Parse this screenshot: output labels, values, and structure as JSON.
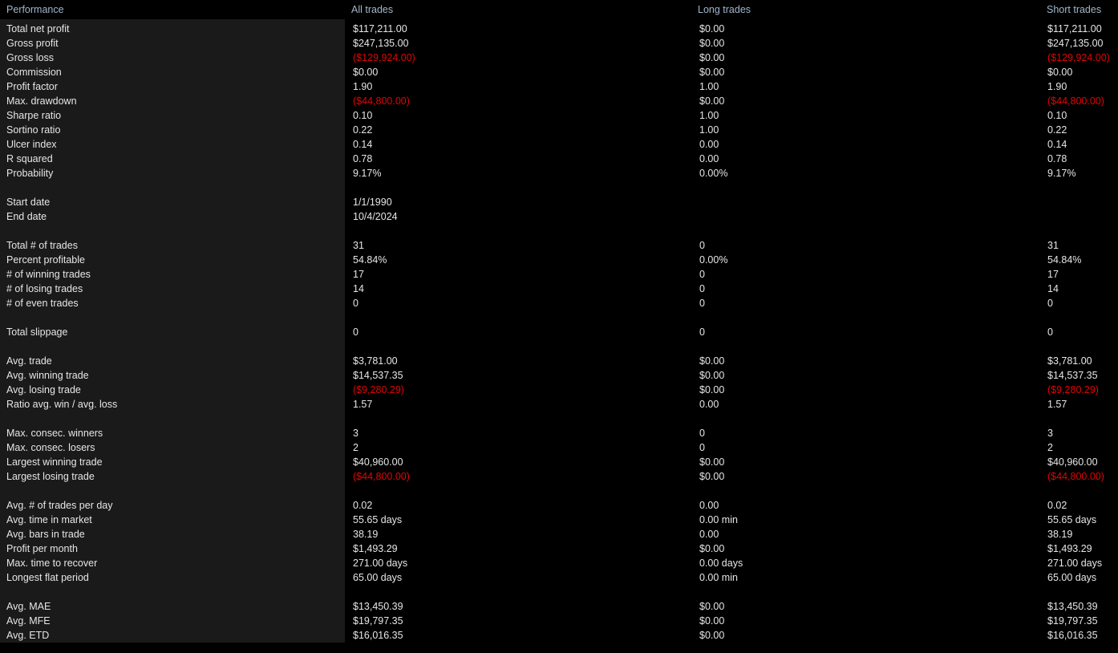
{
  "header": {
    "columns": [
      "Performance",
      "All trades",
      "Long trades",
      "Short trades"
    ]
  },
  "colors": {
    "negative": "#e00505",
    "header_text": "#a3b6ca",
    "value_text": "#e6e6e6",
    "panel_bg": "#1a1a1a",
    "page_bg": "#000000"
  },
  "rows": [
    {
      "label": "Total net profit",
      "all": "$117,211.00",
      "long": "$0.00",
      "short": "$117,211.00"
    },
    {
      "label": "Gross profit",
      "all": "$247,135.00",
      "long": "$0.00",
      "short": "$247,135.00"
    },
    {
      "label": "Gross loss",
      "all": "($129,924.00)",
      "long": "$0.00",
      "short": "($129,924.00)",
      "neg": [
        "all",
        "short"
      ]
    },
    {
      "label": "Commission",
      "all": "$0.00",
      "long": "$0.00",
      "short": "$0.00"
    },
    {
      "label": "Profit factor",
      "all": "1.90",
      "long": "1.00",
      "short": "1.90"
    },
    {
      "label": "Max. drawdown",
      "all": "($44,800.00)",
      "long": "$0.00",
      "short": "($44,800.00)",
      "neg": [
        "all",
        "short"
      ]
    },
    {
      "label": "Sharpe ratio",
      "all": "0.10",
      "long": "1.00",
      "short": "0.10"
    },
    {
      "label": "Sortino ratio",
      "all": "0.22",
      "long": "1.00",
      "short": "0.22"
    },
    {
      "label": "Ulcer index",
      "all": "0.14",
      "long": "0.00",
      "short": "0.14"
    },
    {
      "label": "R squared",
      "all": "0.78",
      "long": "0.00",
      "short": "0.78"
    },
    {
      "label": "Probability",
      "all": "9.17%",
      "long": "0.00%",
      "short": "9.17%"
    },
    {
      "spacer": true
    },
    {
      "label": "Start date",
      "all": "1/1/1990",
      "long": "",
      "short": ""
    },
    {
      "label": "End date",
      "all": "10/4/2024",
      "long": "",
      "short": ""
    },
    {
      "spacer": true
    },
    {
      "label": "Total # of trades",
      "all": "31",
      "long": "0",
      "short": "31"
    },
    {
      "label": "Percent profitable",
      "all": "54.84%",
      "long": "0.00%",
      "short": "54.84%"
    },
    {
      "label": "# of winning trades",
      "all": "17",
      "long": "0",
      "short": "17"
    },
    {
      "label": "# of losing trades",
      "all": "14",
      "long": "0",
      "short": "14"
    },
    {
      "label": "# of even trades",
      "all": "0",
      "long": "0",
      "short": "0"
    },
    {
      "spacer": true
    },
    {
      "label": "Total slippage",
      "all": "0",
      "long": "0",
      "short": "0"
    },
    {
      "spacer": true
    },
    {
      "label": "Avg. trade",
      "all": "$3,781.00",
      "long": "$0.00",
      "short": "$3,781.00"
    },
    {
      "label": "Avg. winning trade",
      "all": "$14,537.35",
      "long": "$0.00",
      "short": "$14,537.35"
    },
    {
      "label": "Avg. losing trade",
      "all": "($9,280.29)",
      "long": "$0.00",
      "short": "($9,280.29)",
      "neg": [
        "all",
        "short"
      ]
    },
    {
      "label": "Ratio avg. win / avg. loss",
      "all": "1.57",
      "long": "0.00",
      "short": "1.57"
    },
    {
      "spacer": true
    },
    {
      "label": "Max. consec. winners",
      "all": "3",
      "long": "0",
      "short": "3"
    },
    {
      "label": "Max. consec. losers",
      "all": "2",
      "long": "0",
      "short": "2"
    },
    {
      "label": "Largest winning trade",
      "all": "$40,960.00",
      "long": "$0.00",
      "short": "$40,960.00"
    },
    {
      "label": "Largest losing trade",
      "all": "($44,800.00)",
      "long": "$0.00",
      "short": "($44,800.00)",
      "neg": [
        "all",
        "short"
      ]
    },
    {
      "spacer": true
    },
    {
      "label": "Avg. # of trades per day",
      "all": "0.02",
      "long": "0.00",
      "short": "0.02"
    },
    {
      "label": "Avg. time in market",
      "all": "55.65 days",
      "long": "0.00 min",
      "short": "55.65 days"
    },
    {
      "label": "Avg. bars in trade",
      "all": "38.19",
      "long": "0.00",
      "short": "38.19"
    },
    {
      "label": "Profit per month",
      "all": "$1,493.29",
      "long": "$0.00",
      "short": "$1,493.29"
    },
    {
      "label": "Max. time to recover",
      "all": "271.00 days",
      "long": "0.00 days",
      "short": "271.00 days"
    },
    {
      "label": "Longest flat period",
      "all": "65.00 days",
      "long": "0.00 min",
      "short": "65.00 days"
    },
    {
      "spacer": true
    },
    {
      "label": "Avg. MAE",
      "all": "$13,450.39",
      "long": "$0.00",
      "short": "$13,450.39"
    },
    {
      "label": "Avg. MFE",
      "all": "$19,797.35",
      "long": "$0.00",
      "short": "$19,797.35"
    },
    {
      "label": "Avg. ETD",
      "all": "$16,016.35",
      "long": "$0.00",
      "short": "$16,016.35"
    }
  ]
}
